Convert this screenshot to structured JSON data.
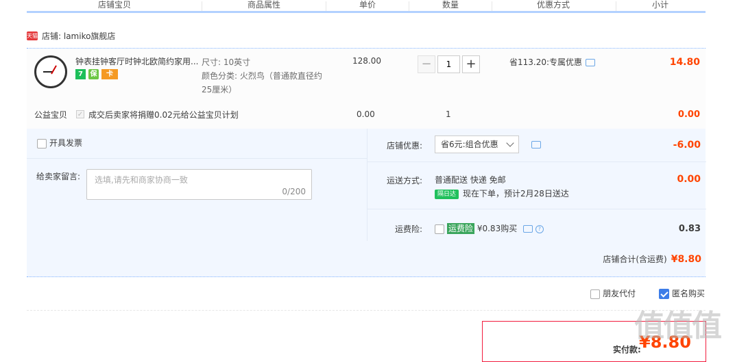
{
  "columns": [
    "店铺宝贝",
    "商品属性",
    "单价",
    "数量",
    "优惠方式",
    "小计"
  ],
  "shop": {
    "badge": "天猫",
    "label": "店铺: lamiko旗舰店"
  },
  "item": {
    "title": "钟表挂钟客厅时钟北欧简约家用...",
    "badges": [
      "7",
      "保",
      "卡"
    ],
    "attr_size": "尺寸: 10英寸",
    "attr_color": "颜色分类: 火烈鸟（普通款直径约25厘米）",
    "price": "128.00",
    "quantity": "1",
    "discount": "省113.20:专属优惠",
    "subtotal": "14.80"
  },
  "charity": {
    "label": "公益宝贝",
    "text": "成交后卖家将捐赠0.02元给公益宝贝计划",
    "price": "0.00",
    "qty": "1",
    "subtotal": "0.00"
  },
  "options": {
    "invoice": "开具发票",
    "message_label": "给卖家留言:",
    "message_placeholder": "选填,请先和商家协商一致",
    "message_count": "0/200",
    "shop_discount_label": "店铺优惠:",
    "shop_discount_value": "省6元:组合优惠",
    "shop_discount_amount": "-6.00",
    "ship_label": "运送方式:",
    "ship_method": "普通配送 快递 免邮",
    "ship_tag": "隔日达",
    "ship_eta": "现在下单，预计2月28日送达",
    "ship_amount": "0.00",
    "insurance_label": "运费险:",
    "insurance_tag": "运费险",
    "insurance_text": "¥0.83购买",
    "insurance_amount": "0.83",
    "total_label": "店铺合计(含运费)",
    "total_amount": "¥8.80"
  },
  "footer": {
    "friend_pay": "朋友代付",
    "anonymous": "匿名购买"
  },
  "payment": {
    "label": "实付款:",
    "amount": "¥8.80"
  },
  "watermark": "值值值"
}
